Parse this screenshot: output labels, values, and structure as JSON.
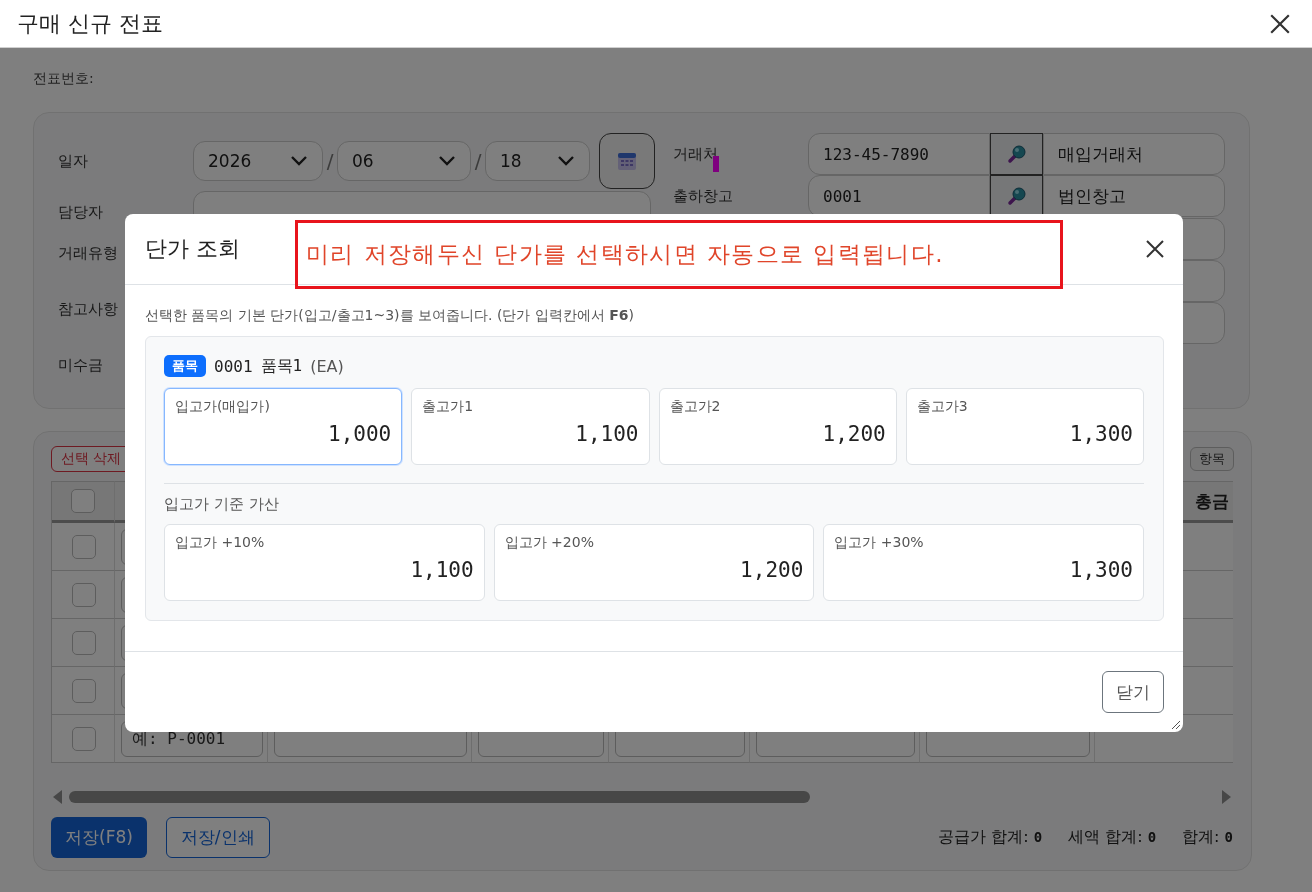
{
  "window": {
    "title": "구매 신규 전표"
  },
  "voucher": {
    "label": "전표번호:"
  },
  "form": {
    "date": {
      "label": "일자",
      "year": "2026",
      "month": "06",
      "day": "18",
      "separators": [
        "/",
        "/"
      ]
    },
    "manager": {
      "label": "담당자"
    },
    "other_labels": [
      "거래유형",
      "참고사항",
      "미수금"
    ],
    "vendor": {
      "label": "거래처",
      "code": "123-45-7890",
      "name": "매입거래처"
    },
    "warehouse": {
      "label": "출하창고",
      "code": "0001",
      "name": "법인창고"
    }
  },
  "table": {
    "delete_button": "선택 삭제",
    "columns_button": "항목",
    "header_checked": false,
    "column_8": "총금",
    "rows": [
      {
        "checked": false
      },
      {
        "checked": false
      },
      {
        "checked": false
      },
      {
        "checked": false
      },
      {
        "checked": false,
        "placeholder": "예: P-0001"
      }
    ]
  },
  "actions": {
    "save": "저장(F8)",
    "save_print": "저장/인쇄"
  },
  "totals": [
    {
      "label": "공급가 합계:",
      "value": "0"
    },
    {
      "label": "세액 합계:",
      "value": "0"
    },
    {
      "label": "합계:",
      "value": "0"
    }
  ],
  "dialog": {
    "title": "단가 조회",
    "annotation": "미리 저장해두신 단가를 선택하시면 자동으로 입력됩니다.",
    "description": "선택한 품목의 기본 단가(입고/출고1~3)를 보여줍니다. (단가 입력칸에서 **F6**)",
    "item": {
      "badge": "품목",
      "code": "0001",
      "name": "품목1",
      "unit": "(EA)"
    },
    "prices": [
      {
        "label": "입고가(매입가)",
        "value": "1,000",
        "selected": true
      },
      {
        "label": "출고가1",
        "value": "1,100",
        "selected": false
      },
      {
        "label": "출고가2",
        "value": "1,200",
        "selected": false
      },
      {
        "label": "출고가3",
        "value": "1,300",
        "selected": false
      }
    ],
    "markup_title": "입고가 기준 가산",
    "markups": [
      {
        "label": "입고가 +10%",
        "value": "1,100",
        "selected": false
      },
      {
        "label": "입고가 +20%",
        "value": "1,200",
        "selected": false
      },
      {
        "label": "입고가 +30%",
        "value": "1,300",
        "selected": false
      }
    ],
    "close_button": "닫기"
  }
}
